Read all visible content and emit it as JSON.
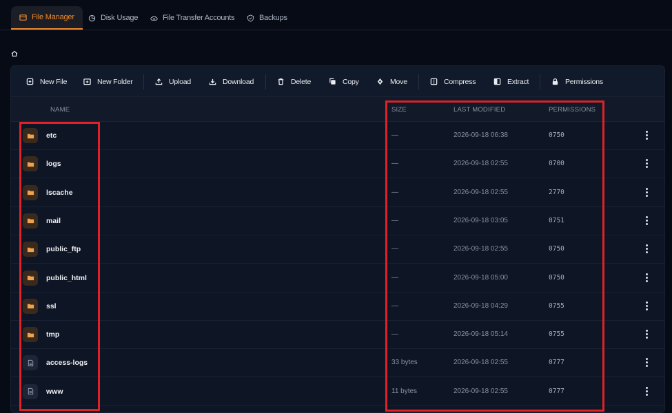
{
  "tabs": [
    {
      "label": "File Manager",
      "icon": "folder-icon",
      "active": true
    },
    {
      "label": "Disk Usage",
      "icon": "pie-chart-icon"
    },
    {
      "label": "File Transfer Accounts",
      "icon": "cloud-icon"
    },
    {
      "label": "Backups",
      "icon": "shield-icon"
    }
  ],
  "breadcrumb": {
    "icon": "home-icon"
  },
  "toolbar": {
    "new_file": "New File",
    "new_folder": "New Folder",
    "upload": "Upload",
    "download": "Download",
    "delete": "Delete",
    "copy": "Copy",
    "move": "Move",
    "compress": "Compress",
    "extract": "Extract",
    "permissions": "Permissions"
  },
  "table": {
    "headers": {
      "name": "NAME",
      "size": "SIZE",
      "modified": "LAST MODIFIED",
      "permissions": "PERMISSIONS"
    },
    "rows": [
      {
        "name": "etc",
        "type": "folder",
        "size": "—",
        "modified": "2026-09-18 06:38",
        "permissions": "0750"
      },
      {
        "name": "logs",
        "type": "folder",
        "size": "—",
        "modified": "2026-09-18 02:55",
        "permissions": "0700"
      },
      {
        "name": "lscache",
        "type": "folder",
        "size": "—",
        "modified": "2026-09-18 02:55",
        "permissions": "2770"
      },
      {
        "name": "mail",
        "type": "folder",
        "size": "—",
        "modified": "2026-09-18 03:05",
        "permissions": "0751"
      },
      {
        "name": "public_ftp",
        "type": "folder",
        "size": "—",
        "modified": "2026-09-18 02:55",
        "permissions": "0750"
      },
      {
        "name": "public_html",
        "type": "folder",
        "size": "—",
        "modified": "2026-09-18 05:00",
        "permissions": "0750"
      },
      {
        "name": "ssl",
        "type": "folder",
        "size": "—",
        "modified": "2026-09-18 04:29",
        "permissions": "0755"
      },
      {
        "name": "tmp",
        "type": "folder",
        "size": "—",
        "modified": "2026-09-18 05:14",
        "permissions": "0755"
      },
      {
        "name": "access-logs",
        "type": "file",
        "size": "33 bytes",
        "modified": "2026-09-18 02:55",
        "permissions": "0777"
      },
      {
        "name": "www",
        "type": "file",
        "size": "11 bytes",
        "modified": "2026-09-18 02:55",
        "permissions": "0777"
      }
    ]
  },
  "colors": {
    "accent": "#f08a2b",
    "highlight": "#e02227",
    "background": "#070b16",
    "panel": "#0e1524"
  }
}
